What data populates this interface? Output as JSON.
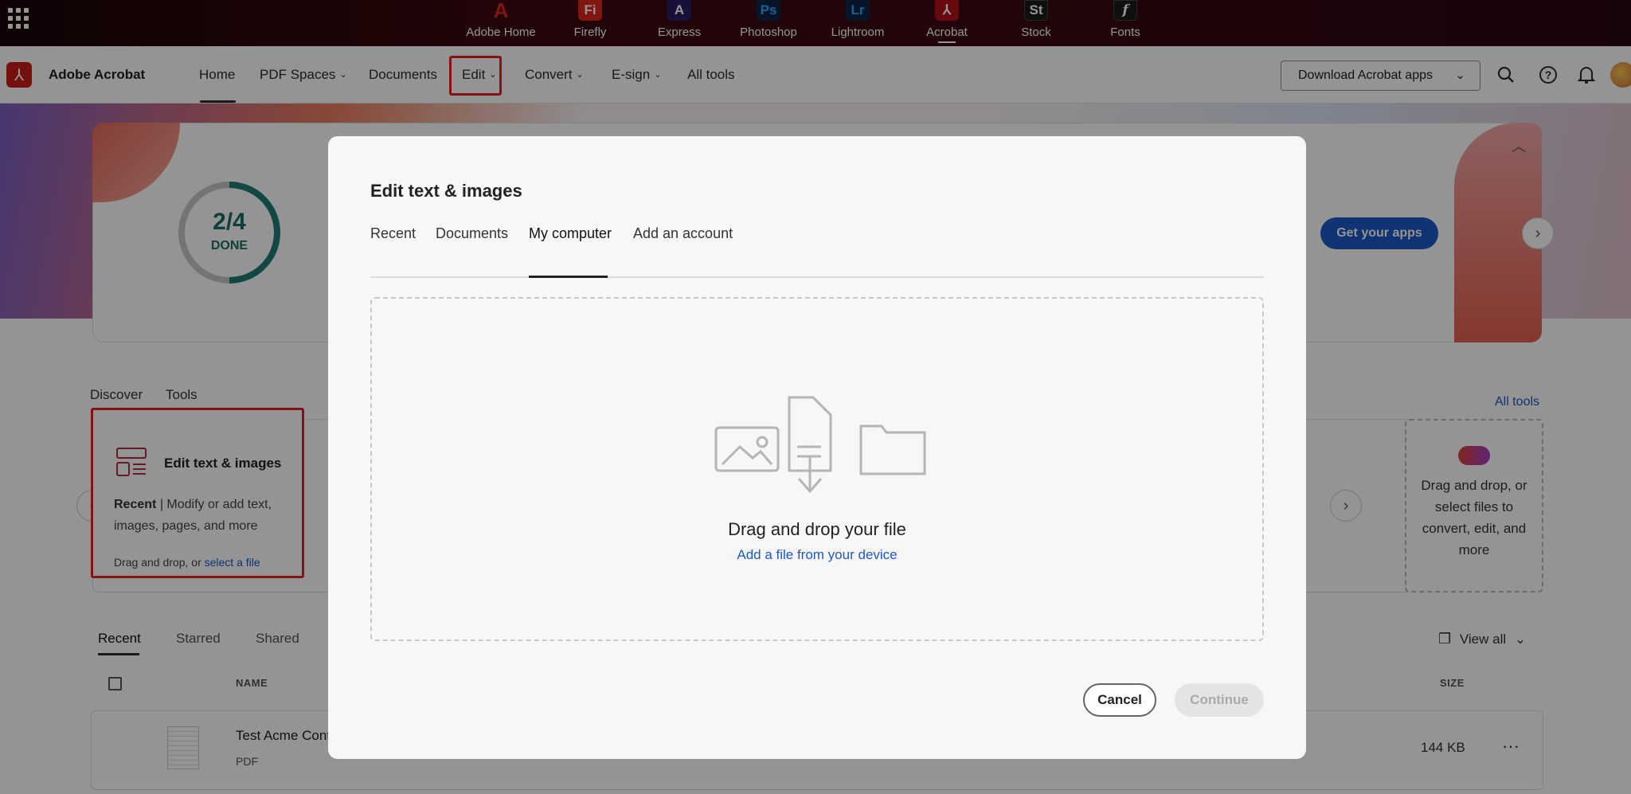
{
  "app_switcher": {
    "apps": [
      {
        "label": "Adobe Home",
        "icon": "adobe-home-icon",
        "glyph": "A",
        "color": "#e1251b"
      },
      {
        "label": "Firefly",
        "icon": "firefly-icon",
        "glyph": "Fi",
        "color": "#e1251b"
      },
      {
        "label": "Express",
        "icon": "express-icon",
        "glyph": "A",
        "color": "#2a1d63"
      },
      {
        "label": "Photoshop",
        "icon": "photoshop-icon",
        "glyph": "Ps",
        "color": "#0b2548"
      },
      {
        "label": "Lightroom",
        "icon": "lightroom-icon",
        "glyph": "Lr",
        "color": "#0b2548"
      },
      {
        "label": "Acrobat",
        "icon": "acrobat-icon",
        "glyph": "⅄",
        "color": "#b3101a"
      },
      {
        "label": "Stock",
        "icon": "stock-icon",
        "glyph": "St",
        "color": "#1a1a1a"
      },
      {
        "label": "Fonts",
        "icon": "fonts-icon",
        "glyph": "f",
        "color": "#1a1a1a"
      }
    ],
    "active": "Acrobat"
  },
  "nav": {
    "brand": "Adobe Acrobat",
    "items": [
      {
        "label": "Home",
        "dropdown": false
      },
      {
        "label": "PDF Spaces",
        "dropdown": true
      },
      {
        "label": "Documents",
        "dropdown": false
      },
      {
        "label": "Edit",
        "dropdown": true
      },
      {
        "label": "Convert",
        "dropdown": true
      },
      {
        "label": "E-sign",
        "dropdown": true
      },
      {
        "label": "All tools",
        "dropdown": false
      }
    ],
    "download_button": "Download Acrobat apps",
    "chevron": "⌄"
  },
  "banner": {
    "progress_value": "2/4",
    "progress_label": "DONE",
    "progress_fraction": 0.5,
    "get_apps": "Get your apps"
  },
  "tools_section": {
    "tabs": [
      "Discover",
      "Tools"
    ],
    "active_tab": "Tools",
    "all_tools": "All tools",
    "card": {
      "title": "Edit text & images",
      "recent_label": "Recent",
      "separator": "|",
      "description": "Modify or add text, images, pages, and more",
      "drop_text": "Drag and drop, or",
      "drop_link": "select a file"
    },
    "drop_card": "Drag and drop, or select files to convert, edit, and more"
  },
  "files": {
    "tabs": [
      "Recent",
      "Starred",
      "Shared"
    ],
    "active_tab": "Recent",
    "view_all": "View all",
    "columns": {
      "name": "NAME",
      "size": "SIZE"
    },
    "rows": [
      {
        "name": "Test Acme Cont",
        "type": "PDF",
        "size": "144 KB"
      }
    ],
    "more_glyph": "···"
  },
  "modal": {
    "title": "Edit text & images",
    "tabs": [
      "Recent",
      "Documents",
      "My computer",
      "Add an account"
    ],
    "active_tab": "My computer",
    "drop_title": "Drag and drop your file",
    "drop_link": "Add a file from your device",
    "cancel": "Cancel",
    "continue": "Continue"
  },
  "colors": {
    "accent_red": "#e52222",
    "link_blue": "#1b58c7",
    "progress_teal": "#1e7c74"
  }
}
